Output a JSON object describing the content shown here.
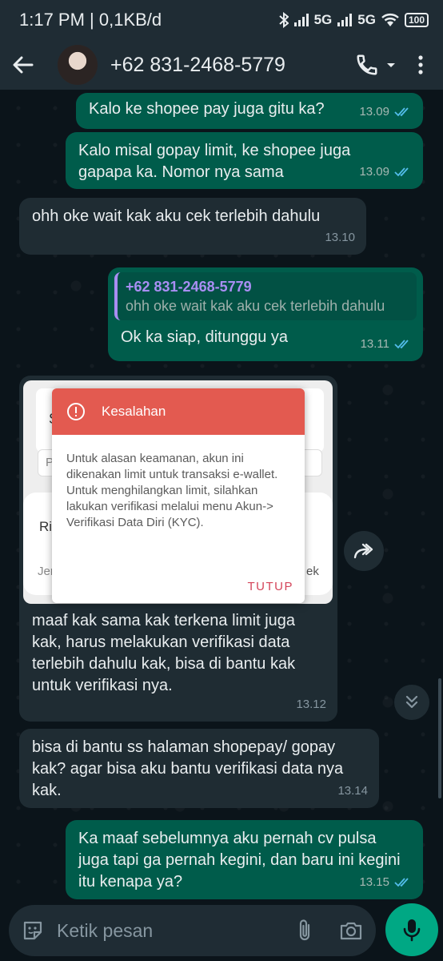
{
  "status_bar": {
    "time_info": "1:17 PM | 0,1KB/d",
    "net1": "5G",
    "net2": "5G",
    "battery": "100"
  },
  "header": {
    "contact_name": "+62 831-2468-5779"
  },
  "messages": [
    {
      "dir": "out",
      "text": "Kalo ke shopee pay juga gitu ka?",
      "time": "13.09"
    },
    {
      "dir": "out",
      "text": "Kalo misal gopay limit, ke shopee juga gapapa ka. Nomor nya sama",
      "time": "13.09"
    },
    {
      "dir": "in",
      "text": "ohh oke wait kak aku cek terlebih dahulu",
      "time": "13.10"
    },
    {
      "dir": "out",
      "quote_name": "+62 831-2468-5779",
      "quote_text": "ohh oke wait kak aku cek terlebih dahulu",
      "text": "Ok ka siap, ditunggu ya",
      "time": "13.11"
    },
    {
      "dir": "in",
      "text": "maaf kak sama kak terkena limit juga kak, harus melakukan verifikasi data terlebih dahulu kak, bisa di bantu kak untuk verifikasi nya.",
      "time": "13.12"
    },
    {
      "dir": "in",
      "text": "bisa di bantu ss halaman shopepay/ gopay kak? agar bisa aku bantu verifikasi data nya kak.",
      "time": "13.14"
    },
    {
      "dir": "out",
      "text": "Ka maaf sebelumnya aku pernah cv pulsa juga tapi ga pernah kegini, dan baru ini kegini itu kenapa ya?",
      "time": "13.15"
    }
  ],
  "screenshot": {
    "dialog_title": "Kesalahan",
    "dialog_body": "Untuk alasan keamanan, akun ini dikenakan limit untuk transaksi e-wallet.  Untuk menghilangkan limit, silahkan lakukan verifikasi melalui menu Akun-> Verifikasi Data Diri (KYC).",
    "dialog_button": "TUTUP",
    "bg_fragments": [
      "S",
      "P",
      "Ri",
      "Jer",
      "ek"
    ]
  },
  "composer": {
    "placeholder": "Ketik pesan"
  },
  "colors": {
    "outgoing_bubble": "#005c4b",
    "incoming_bubble": "#1f2c33",
    "read_ticks": "#53bdeb",
    "dialog_header": "#e35a50",
    "mic_button": "#00a884"
  }
}
